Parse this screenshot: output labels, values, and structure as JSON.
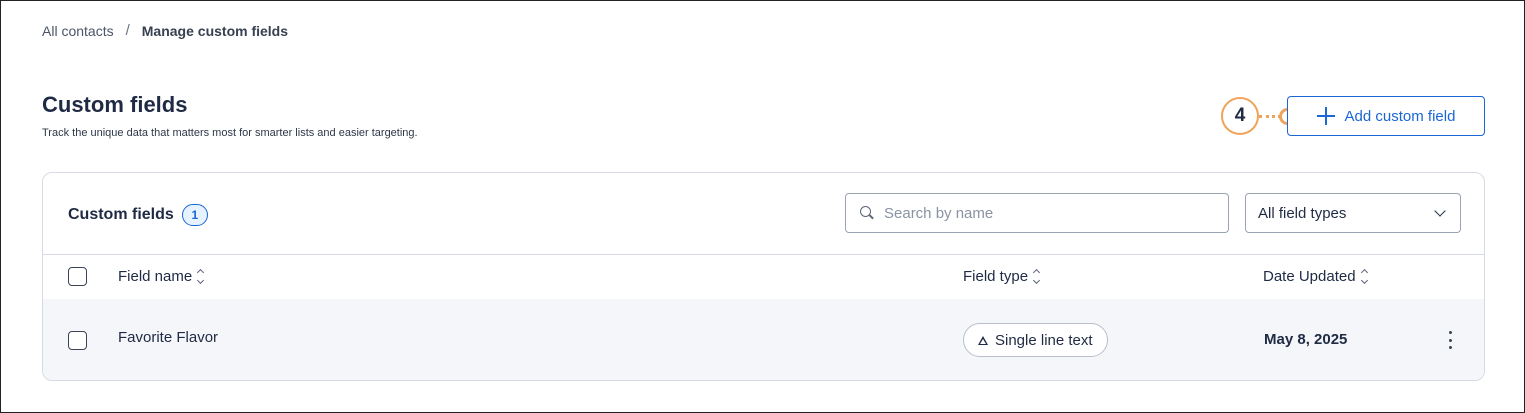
{
  "breadcrumb": {
    "parent": "All contacts",
    "separator": "/",
    "current": "Manage custom fields"
  },
  "header": {
    "title": "Custom fields",
    "subtitle": "Track the unique data that matters most for smarter lists and easier targeting.",
    "add_button_label": "Add custom field",
    "annotation_number": "4"
  },
  "card": {
    "title": "Custom fields",
    "count": "1",
    "search": {
      "placeholder": "Search by name",
      "value": ""
    },
    "filter": {
      "selected": "All field types"
    },
    "columns": [
      "Field name",
      "Field type",
      "Date Updated"
    ],
    "rows": [
      {
        "name": "Favorite Flavor",
        "type": "Single line text",
        "date": "May 8, 2025"
      }
    ]
  },
  "colors": {
    "accent": "#1a66d6",
    "annotation": "#f0a35a",
    "row_bg": "#f4f6f9",
    "border": "#d6dbe3"
  },
  "icons": [
    "plus-icon",
    "search-icon",
    "chevron-down-icon",
    "sort-icon",
    "text-type-icon",
    "more-vertical-icon"
  ]
}
